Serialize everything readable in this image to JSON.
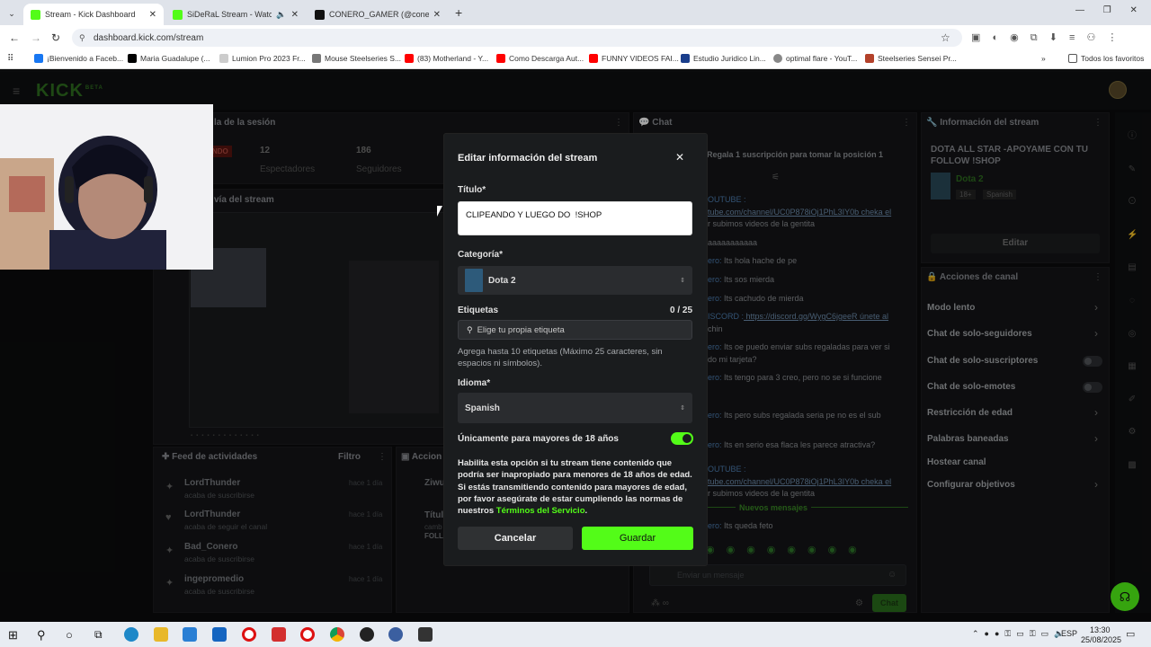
{
  "browser": {
    "tabs": [
      {
        "label": "Stream - Kick Dashboard",
        "active": true
      },
      {
        "label": "SiDeRaL Stream - Watch Liv"
      },
      {
        "label": "CONERO_GAMER (@conero_g"
      }
    ],
    "url": "dashboard.kick.com/stream",
    "bookmarks": [
      "¡Bienvenido a Faceb...",
      "Maria Guadalupe (...",
      "Lumion Pro 2023 Fr...",
      "Mouse Steelseries S...",
      "(83) Motherland - Y...",
      "Como Descarga Aut...",
      "FUNNY VIDEOS FAI...",
      "Estudio Juridico Lin...",
      "optimal flare - YouT...",
      "Steelseries Sensei Pr..."
    ],
    "all_bookmarks": "Todos los favoritos"
  },
  "kick": {
    "logo": "KICK",
    "beta": "BETA"
  },
  "session": {
    "title": "la de la sesión",
    "badge": "NDO",
    "viewers_value": "12",
    "viewers_label": "Espectadores",
    "followers_value": "186",
    "followers_label": "Seguidores",
    "preview_title": "vía del stream"
  },
  "feed": {
    "title": "Feed de actividades",
    "filter": "Filtro",
    "items": [
      {
        "user": "LordThunder",
        "action": "acaba de suscribirse",
        "time": "hace 1 día"
      },
      {
        "user": "LordThunder",
        "action": "acaba de seguir el canal",
        "time": "hace 1 día"
      },
      {
        "user": "Bad_Conero",
        "action": "acaba de suscribirse",
        "time": "hace 1 día"
      },
      {
        "user": "ingepromedio",
        "action": "acaba de suscribirse",
        "time": "hace 1 día"
      }
    ]
  },
  "actions_panel": {
    "title": "Accion",
    "item1": "Ziwu",
    "item2": "Títul",
    "item2b": "camb",
    "item2c": "FOLL"
  },
  "chat": {
    "title": "Chat",
    "pinned": "Regala 1 suscripción para tomar la posición 1",
    "lines": [
      {
        "u": "OUTUBE :",
        "t": ""
      },
      {
        "u": "",
        "t": "tube.com/channel/UC0P878iOj1PhL3IY0b cheka el"
      },
      {
        "u": "",
        "t": "r subimos videos de la gentita"
      },
      {
        "u": "",
        "t": "aaaaaaaaaaa"
      },
      {
        "u": "ero:",
        "t": " Its hola hache de pe"
      },
      {
        "u": "ero:",
        "t": " Its sos mierda"
      },
      {
        "u": "ero:",
        "t": " Its cachudo de mierda"
      },
      {
        "u": "ISCORD :",
        "t": " https://discord.gg/WygC6jgeeR únete al"
      },
      {
        "u": "",
        "t": "chin"
      },
      {
        "u": "ero:",
        "t": " Its oe puedo enviar subs regaladas para ver si"
      },
      {
        "u": "",
        "t": "do mi tarjeta?"
      },
      {
        "u": "ero:",
        "t": " Its tengo para 3 creo, pero no se si funcione"
      },
      {
        "u": "ero:",
        "t": " Its pero subs regalada seria pe no es el sub"
      },
      {
        "u": "ero:",
        "t": " Its en serio esa flaca les parece atractiva?"
      },
      {
        "u": "OUTUBE :",
        "t": ""
      },
      {
        "u": "",
        "t": "tube.com/channel/UC0P878iOj1PhL3IY0b cheka el"
      },
      {
        "u": "",
        "t": "r subimos videos de la gentita"
      },
      {
        "u": "ero:",
        "t": " Its queda feto"
      }
    ],
    "new_messages": "Nuevos mensajes",
    "placeholder": "Enviar un mensaje",
    "send": "Chat"
  },
  "stream_info": {
    "title": "Información del stream",
    "stream_title": "DOTA ALL STAR -APOYAME CON TU FOLLOW !SHOP",
    "game": "Dota 2",
    "age": "18+",
    "lang": "Spanish",
    "edit": "Editar"
  },
  "channel_actions": {
    "title": "Acciones de canal",
    "items": [
      "Modo lento",
      "Chat de solo-seguidores",
      "Chat de solo-suscriptores",
      "Chat de solo-emotes",
      "Restricción de edad",
      "Palabras baneadas",
      "Hostear canal",
      "Configurar objetivos"
    ]
  },
  "modal": {
    "title": "Editar información del stream",
    "title_label": "Título*",
    "title_value": "CLIPEANDO Y LUEGO DO  !SHOP",
    "category_label": "Categoría*",
    "category_value": "Dota 2",
    "tags_label": "Etiquetas",
    "tags_count": "0 / 25",
    "tags_placeholder": "Elige tu propia etiqueta",
    "tags_help": "Agrega hasta 10 etiquetas (Máximo 25 caracteres, sin espacios ni símbolos).",
    "language_label": "Idioma*",
    "language_value": "Spanish",
    "adult_label": "Únicamente para mayores de 18 años",
    "adult_on": true,
    "adult_help": "Habilita esta opción si tu stream tiene contenido que podría ser inapropiado para menores de 18 años de edad. Si estás transmitiendo contenido para mayores de edad, por favor asegúrate de estar cumpliendo las normas de nuestros",
    "terms_link": "Términos del Servicio",
    "period": ".",
    "cancel": "Cancelar",
    "save": "Guardar",
    "accent": "#53fc18"
  },
  "taskbar": {
    "lang": "ESP",
    "time": "13:30",
    "date": "25/08/2025"
  }
}
